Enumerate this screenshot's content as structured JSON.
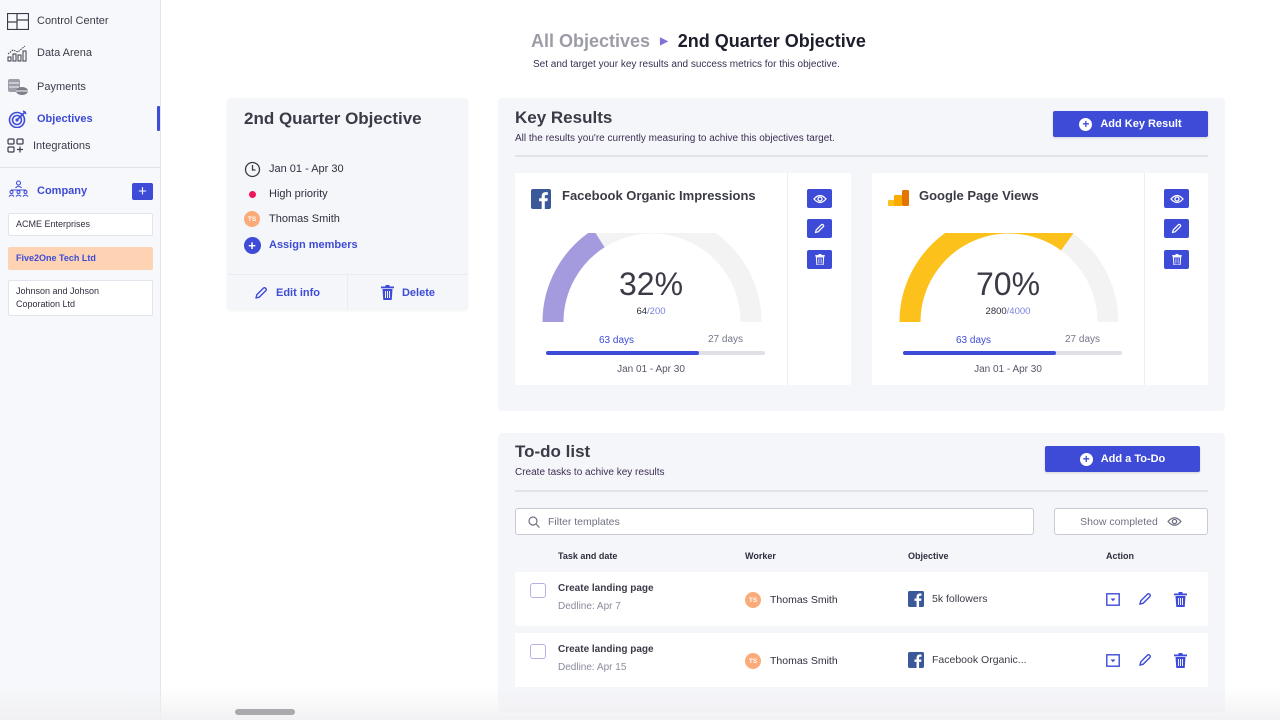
{
  "sidebar": {
    "nav": [
      {
        "label": "Control Center",
        "icon": "layout-icon",
        "active": false
      },
      {
        "label": "Data Arena",
        "icon": "chart-icon",
        "active": false
      },
      {
        "label": "Payments",
        "icon": "coins-icon",
        "active": false
      },
      {
        "label": "Objectives",
        "icon": "target-icon",
        "active": true
      },
      {
        "label": "Integrations",
        "icon": "integrations-icon",
        "active": false
      }
    ],
    "company": {
      "label": "Company",
      "add_label": "+",
      "items": [
        {
          "label": "ACME Enterprises",
          "selected": false
        },
        {
          "label": "Five2One Tech Ltd",
          "selected": true
        },
        {
          "label": "Johnson and Johson Coporation Ltd",
          "selected": false
        }
      ]
    }
  },
  "header": {
    "breadcrumb_parent": "All Objectives",
    "breadcrumb_sep": "▶",
    "breadcrumb_current": "2nd Quarter Objective",
    "subtitle": "Set and target your key results and success metrics for this objective."
  },
  "objective": {
    "title": "2nd Quarter Objective",
    "date_range": "Jan 01 - Apr 30",
    "priority": "High priority",
    "priority_color": "#f0145a",
    "owner": {
      "name": "Thomas Smith",
      "initials": "TS"
    },
    "assign_label": "Assign members",
    "edit_label": "Edit info",
    "delete_label": "Delete"
  },
  "key_results": {
    "title": "Key Results",
    "description": "All the results you're currently measuring to achive this objectives target.",
    "add_label": "Add Key Result",
    "cards": [
      {
        "title": "Facebook Organic Impressions",
        "source": "facebook",
        "percent_label": "32%",
        "percent": 32,
        "current": "64",
        "target": "/200",
        "gauge_color": "#a49ade",
        "days_elapsed": "63 days",
        "days_left": "27 days",
        "time_progress": 0.7,
        "range": "Jan 01 - Apr 30"
      },
      {
        "title": "Google Page Views",
        "source": "google-analytics",
        "percent_label": "70%",
        "percent": 70,
        "current": "2800",
        "target": "/4000",
        "gauge_color": "#fcc21b",
        "days_elapsed": "63 days",
        "days_left": "27 days",
        "time_progress": 0.7,
        "range": "Jan 01 - Apr 30"
      }
    ]
  },
  "todo": {
    "title": "To-do list",
    "description": "Create tasks to achive key results",
    "add_label": "Add a To-Do",
    "filter_placeholder": "Filter templates",
    "show_completed_label": "Show completed",
    "columns": [
      "Task and date",
      "Worker",
      "Objective",
      "Action"
    ],
    "rows": [
      {
        "task": "Create landing page",
        "deadline": "Dedline: Apr 7",
        "worker": "Thomas Smith",
        "worker_initials": "TS",
        "objective": "5k followers",
        "checked": false
      },
      {
        "task": "Create landing page",
        "deadline": "Dedline: Apr 15",
        "worker": "Thomas Smith",
        "worker_initials": "TS",
        "objective": "Facebook Organic...",
        "checked": false
      }
    ]
  },
  "colors": {
    "accent": "#3d4bd6",
    "selected_company_bg": "#fdd3b4",
    "avatar": "#fbab79",
    "facebook": "#3b5998"
  }
}
